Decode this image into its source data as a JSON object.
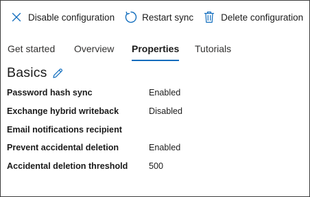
{
  "toolbar": {
    "disable_label": "Disable configuration",
    "restart_label": "Restart sync",
    "delete_label": "Delete configuration"
  },
  "icons": {
    "disable": "close-icon",
    "restart": "refresh-icon",
    "delete": "trash-icon",
    "edit": "pencil-icon"
  },
  "tabs": [
    {
      "label": "Get started",
      "active": false
    },
    {
      "label": "Overview",
      "active": false
    },
    {
      "label": "Properties",
      "active": true
    },
    {
      "label": "Tutorials",
      "active": false
    }
  ],
  "section": {
    "title": "Basics"
  },
  "properties": [
    {
      "label": "Password hash sync",
      "value": "Enabled"
    },
    {
      "label": "Exchange hybrid writeback",
      "value": "Disabled"
    },
    {
      "label": "Email notifications recipient",
      "value": ""
    },
    {
      "label": "Prevent accidental deletion",
      "value": "Enabled"
    },
    {
      "label": "Accidental deletion threshold",
      "value": "500"
    }
  ],
  "colors": {
    "accent": "#0f6cbd",
    "text": "#1b1b1b",
    "border": "#3c3c3c"
  }
}
